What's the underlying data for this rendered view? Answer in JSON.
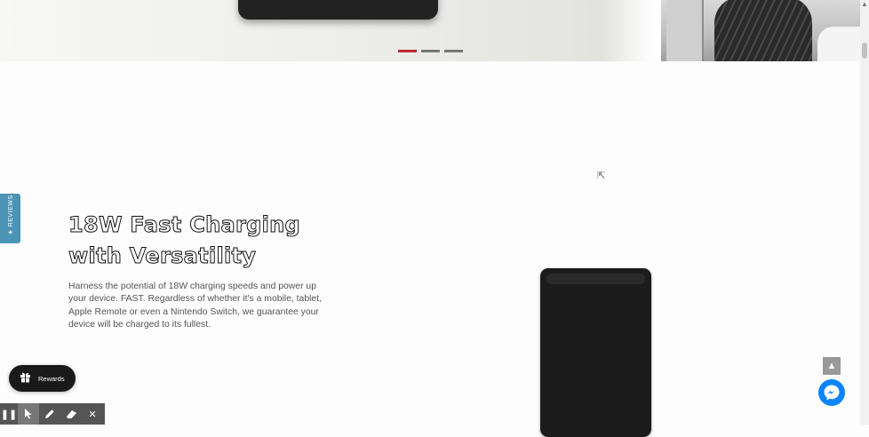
{
  "hero": {
    "slides": [
      {
        "label": "slide-1",
        "active": true
      },
      {
        "label": "slide-2",
        "active": false
      },
      {
        "label": "slide-3",
        "active": false
      }
    ]
  },
  "reviews_tab": {
    "label": "★ REVIEWS"
  },
  "feature": {
    "title_line1": "18W Fast Charging",
    "title_line2": "with Versatility",
    "description": "Harness the potential of 18W charging speeds and power up your device. FAST. Regardless of whether it's a mobile, tablet, Apple Remote or even a Nintendo Switch, we guarantee your device will be charged to its fullest."
  },
  "rewards": {
    "label": "Rewards",
    "icon": "gift-icon"
  },
  "widgets": {
    "back_to_top_icon": "chevron-up-icon",
    "messenger_icon": "messenger-icon"
  },
  "toolbar": {
    "tools": [
      "pause-icon",
      "pointer-icon",
      "pencil-icon",
      "eraser-icon",
      "close-icon"
    ],
    "selected": "pointer-icon"
  },
  "colors": {
    "accent": "#c0272d",
    "reviews_tab": "#4b94b5",
    "messenger": "#0b84ff",
    "rewards_bg": "#1a1a1a"
  }
}
